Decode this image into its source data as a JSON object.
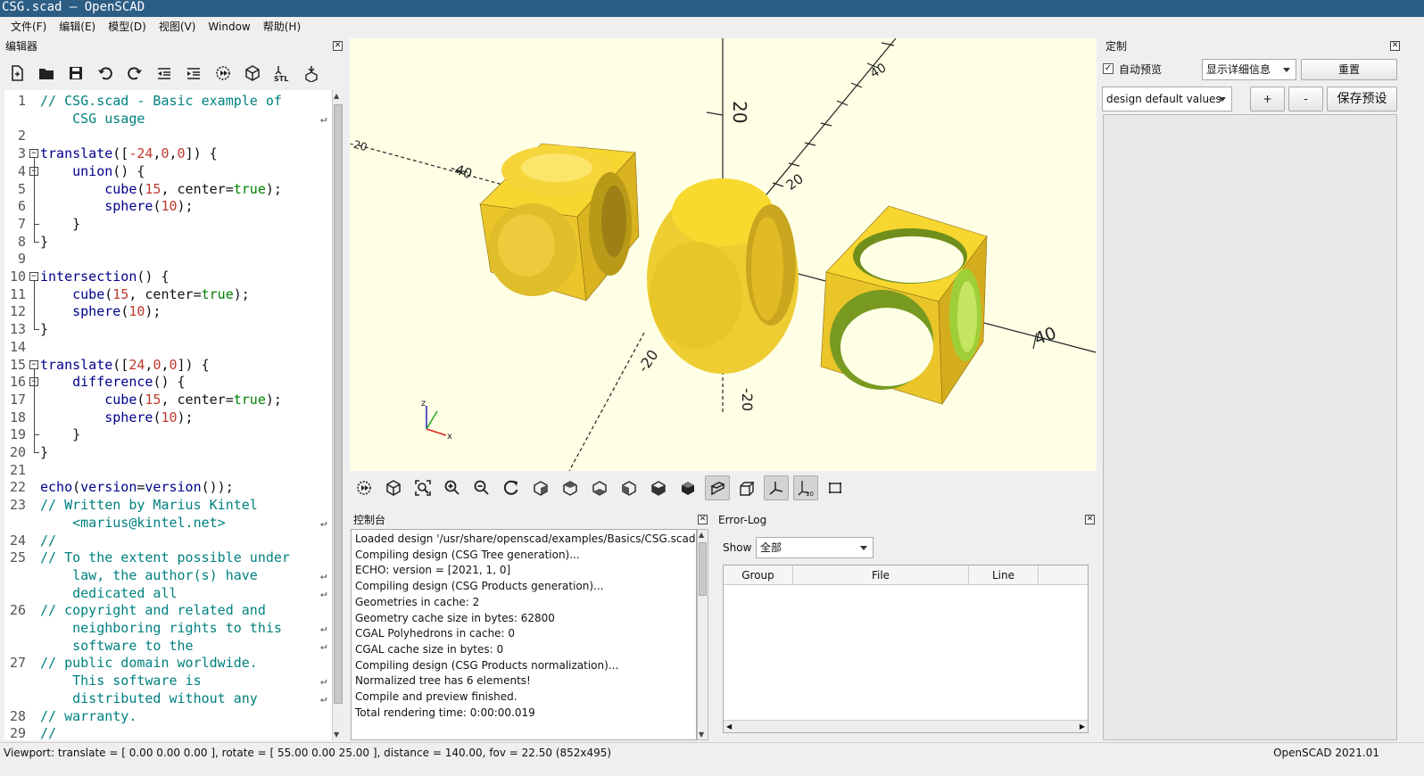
{
  "window": {
    "title": "CSG.scad — OpenSCAD"
  },
  "menu": [
    "文件(F)",
    "编辑(E)",
    "模型(D)",
    "视图(V)",
    "Window",
    "帮助(H)"
  ],
  "editor": {
    "title": "编辑器",
    "toolbar_icons": [
      "new-file-icon",
      "open-file-icon",
      "save-icon",
      "undo-icon",
      "redo-icon",
      "unindent-icon",
      "indent-icon",
      "preview-icon",
      "render-icon",
      "export-stl-icon",
      "send-to-printer-icon"
    ],
    "stl_label": "STL",
    "lines": [
      {
        "n": "1",
        "segs": [
          [
            "cm",
            "// CSG.scad - Basic example of"
          ]
        ]
      },
      {
        "n": "",
        "segs": [
          [
            "cm",
            "    CSG usage"
          ]
        ]
      },
      {
        "n": "2",
        "segs": []
      },
      {
        "n": "3",
        "segs": [
          [
            "kw",
            "translate"
          ],
          [
            "",
            "(["
          ],
          [
            "num",
            "-24"
          ],
          [
            "",
            ","
          ],
          [
            "num",
            "0"
          ],
          [
            "",
            ","
          ],
          [
            "num",
            "0"
          ],
          [
            "",
            "]) {"
          ]
        ]
      },
      {
        "n": "4",
        "segs": [
          [
            "",
            "    "
          ],
          [
            "kw",
            "union"
          ],
          [
            "",
            "() {"
          ]
        ]
      },
      {
        "n": "5",
        "segs": [
          [
            "",
            "        "
          ],
          [
            "kw",
            "cube"
          ],
          [
            "",
            "("
          ],
          [
            "num",
            "15"
          ],
          [
            "",
            ", center="
          ],
          [
            "bool",
            "true"
          ],
          [
            "",
            ");"
          ]
        ]
      },
      {
        "n": "6",
        "segs": [
          [
            "",
            "        "
          ],
          [
            "kw",
            "sphere"
          ],
          [
            "",
            "("
          ],
          [
            "num",
            "10"
          ],
          [
            "",
            ");"
          ]
        ]
      },
      {
        "n": "7",
        "segs": [
          [
            "",
            "    }"
          ]
        ]
      },
      {
        "n": "8",
        "segs": [
          [
            "",
            "}"
          ]
        ]
      },
      {
        "n": "9",
        "segs": []
      },
      {
        "n": "10",
        "segs": [
          [
            "kw",
            "intersection"
          ],
          [
            "",
            "() {"
          ]
        ]
      },
      {
        "n": "11",
        "segs": [
          [
            "",
            "    "
          ],
          [
            "kw",
            "cube"
          ],
          [
            "",
            "("
          ],
          [
            "num",
            "15"
          ],
          [
            "",
            ", center="
          ],
          [
            "bool",
            "true"
          ],
          [
            "",
            ");"
          ]
        ]
      },
      {
        "n": "12",
        "segs": [
          [
            "",
            "    "
          ],
          [
            "kw",
            "sphere"
          ],
          [
            "",
            "("
          ],
          [
            "num",
            "10"
          ],
          [
            "",
            ");"
          ]
        ]
      },
      {
        "n": "13",
        "segs": [
          [
            "",
            "}"
          ]
        ]
      },
      {
        "n": "14",
        "segs": []
      },
      {
        "n": "15",
        "segs": [
          [
            "kw",
            "translate"
          ],
          [
            "",
            "(["
          ],
          [
            "num",
            "24"
          ],
          [
            "",
            ","
          ],
          [
            "num",
            "0"
          ],
          [
            "",
            ","
          ],
          [
            "num",
            "0"
          ],
          [
            "",
            "]) {"
          ]
        ]
      },
      {
        "n": "16",
        "segs": [
          [
            "",
            "    "
          ],
          [
            "kw",
            "difference"
          ],
          [
            "",
            "() {"
          ]
        ]
      },
      {
        "n": "17",
        "segs": [
          [
            "",
            "        "
          ],
          [
            "kw",
            "cube"
          ],
          [
            "",
            "("
          ],
          [
            "num",
            "15"
          ],
          [
            "",
            ", center="
          ],
          [
            "bool",
            "true"
          ],
          [
            "",
            ");"
          ]
        ]
      },
      {
        "n": "18",
        "segs": [
          [
            "",
            "        "
          ],
          [
            "kw",
            "sphere"
          ],
          [
            "",
            "("
          ],
          [
            "num",
            "10"
          ],
          [
            "",
            ");"
          ]
        ]
      },
      {
        "n": "19",
        "segs": [
          [
            "",
            "    }"
          ]
        ]
      },
      {
        "n": "20",
        "segs": [
          [
            "",
            "}"
          ]
        ]
      },
      {
        "n": "21",
        "segs": []
      },
      {
        "n": "22",
        "segs": [
          [
            "kw",
            "echo"
          ],
          [
            "",
            "("
          ],
          [
            "kw",
            "version"
          ],
          [
            "",
            "="
          ],
          [
            "kw",
            "version"
          ],
          [
            "",
            "());"
          ]
        ]
      },
      {
        "n": "23",
        "segs": [
          [
            "cm",
            "// Written by Marius Kintel"
          ]
        ]
      },
      {
        "n": "",
        "segs": [
          [
            "cm",
            "    <marius@kintel.net>"
          ]
        ]
      },
      {
        "n": "24",
        "segs": [
          [
            "cm",
            "//"
          ]
        ]
      },
      {
        "n": "25",
        "segs": [
          [
            "cm",
            "// To the extent possible under"
          ]
        ]
      },
      {
        "n": "",
        "segs": [
          [
            "cm",
            "    law, the author(s) have"
          ]
        ]
      },
      {
        "n": "",
        "segs": [
          [
            "cm",
            "    dedicated all"
          ]
        ]
      },
      {
        "n": "26",
        "segs": [
          [
            "cm",
            "// copyright and related and"
          ]
        ]
      },
      {
        "n": "",
        "segs": [
          [
            "cm",
            "    neighboring rights to this"
          ]
        ]
      },
      {
        "n": "",
        "segs": [
          [
            "cm",
            "    software to the"
          ]
        ]
      },
      {
        "n": "27",
        "segs": [
          [
            "cm",
            "// public domain worldwide."
          ]
        ]
      },
      {
        "n": "",
        "segs": [
          [
            "cm",
            "    This software is"
          ]
        ]
      },
      {
        "n": "",
        "segs": [
          [
            "cm",
            "    distributed without any"
          ]
        ]
      },
      {
        "n": "28",
        "segs": [
          [
            "cm",
            "// warranty."
          ]
        ]
      },
      {
        "n": "29",
        "segs": [
          [
            "cm",
            "//"
          ]
        ]
      }
    ]
  },
  "viewport": {
    "axis_labels": {
      "z20": "20",
      "x40": "40",
      "xneg40": "-40",
      "y20": "20",
      "y40": "40",
      "yneg20": "-20",
      "xneg20": "-20",
      "zneg20": "-20"
    },
    "gizmo": {
      "x": "x",
      "z": "z"
    },
    "toolbar_icons": [
      "preview-icon",
      "render-icon",
      "view-all-icon",
      "zoom-in-icon",
      "zoom-out-icon",
      "reset-view-icon",
      "view-right-icon",
      "view-top-icon",
      "view-bottom-icon",
      "view-left-icon",
      "view-front-icon",
      "view-back-icon",
      "perspective-icon",
      "orthogonal-icon",
      "show-axes-icon",
      "show-scale-icon",
      "show-edges-icon"
    ],
    "scale_label": "10"
  },
  "console": {
    "title": "控制台",
    "lines": [
      "Loaded design '/usr/share/openscad/examples/Basics/CSG.scad'.",
      "Compiling design (CSG Tree generation)...",
      "ECHO: version = [2021, 1, 0]",
      "Compiling design (CSG Products generation)...",
      "Geometries in cache: 2",
      "Geometry cache size in bytes: 62800",
      "CGAL Polyhedrons in cache: 0",
      "CGAL cache size in bytes: 0",
      "Compiling design (CSG Products normalization)...",
      "Normalized tree has 6 elements!",
      "Compile and preview finished.",
      "Total rendering time: 0:00:00.019"
    ]
  },
  "errorlog": {
    "title": "Error-Log",
    "show_label": "Show",
    "show_value": "全部",
    "columns": [
      "Group",
      "File",
      "Line"
    ]
  },
  "customizer": {
    "title": "定制",
    "auto_preview_label": "自动预览",
    "auto_preview_checked": true,
    "detail_combo": "显示详细信息",
    "reset_button": "重置",
    "preset_combo": "design default values",
    "add_button": "+",
    "remove_button": "-",
    "save_preset_button": "保存预设"
  },
  "status": {
    "viewport_info": "Viewport: translate = [ 0.00 0.00 0.00 ], rotate = [ 55.00 0.00 25.00 ], distance = 140.00, fov = 22.50 (852x495)",
    "version": "OpenSCAD 2021.01"
  },
  "colors": {
    "titlebar": "#2c5d85",
    "viewport_bg": "#ffffe5",
    "model_yellow": "#f9d72c",
    "model_inner": "#9acd32",
    "comment": "#008080",
    "keyword": "#00008b",
    "number": "#c0392b",
    "bool": "#008000"
  }
}
